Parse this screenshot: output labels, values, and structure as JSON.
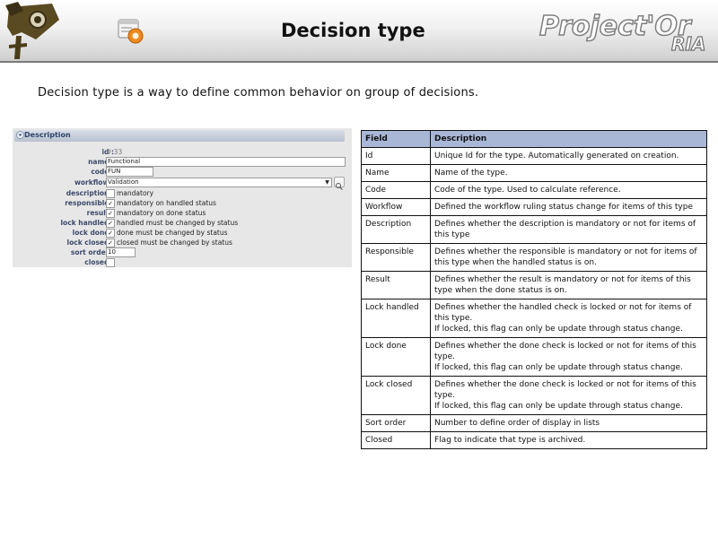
{
  "header": {
    "title": "Decision type",
    "brand": {
      "main": "Project'Or",
      "sub": "RIA"
    }
  },
  "intro": "Decision type is a way to define common behavior on group of decisions.",
  "form": {
    "section_title": "Description",
    "rows": [
      {
        "label": "id :",
        "type": "text",
        "value": "# 33",
        "muted": true
      },
      {
        "label": "name :",
        "type": "input",
        "value": "Functional"
      },
      {
        "label": "code :",
        "type": "input",
        "value": "FUN"
      },
      {
        "label": "workflow :",
        "type": "select",
        "value": "Validation"
      },
      {
        "label": "description :",
        "type": "checkbox",
        "checked": false,
        "text": "mandatory"
      },
      {
        "label": "responsible :",
        "type": "checkbox",
        "checked": true,
        "text": "mandatory on handled status"
      },
      {
        "label": "result :",
        "type": "checkbox",
        "checked": true,
        "text": "mandatory on done status"
      },
      {
        "label": "lock handled :",
        "type": "checkbox",
        "checked": true,
        "text": "handled must be changed by status"
      },
      {
        "label": "lock done :",
        "type": "checkbox",
        "checked": true,
        "text": "done must be changed by status"
      },
      {
        "label": "lock closed :",
        "type": "checkbox",
        "checked": true,
        "text": "closed must be changed by status"
      },
      {
        "label": "sort order :",
        "type": "input",
        "value": "10"
      },
      {
        "label": "closed :",
        "type": "checkbox",
        "checked": false,
        "text": ""
      }
    ]
  },
  "table": {
    "headers": [
      "Field",
      "Description"
    ],
    "rows": [
      {
        "field": "Id",
        "desc": [
          "Unique Id for the type. Automatically generated on creation."
        ]
      },
      {
        "field": "Name",
        "desc": [
          "Name of the type."
        ]
      },
      {
        "field": "Code",
        "desc": [
          "Code of the type. Used to calculate reference."
        ]
      },
      {
        "field": "Workflow",
        "desc": [
          "Defined the workflow ruling status change for items of this type"
        ]
      },
      {
        "field": "Description",
        "desc": [
          "Defines whether the description is mandatory or not for items of this type"
        ]
      },
      {
        "field": "Responsible",
        "desc": [
          "Defines whether the responsible is mandatory or not for items of this type when the handled status is on."
        ]
      },
      {
        "field": "Result",
        "desc": [
          "Defines whether the result is mandatory or not for items of this type when the done status is on."
        ]
      },
      {
        "field": "Lock handled",
        "desc": [
          "Defines whether the handled check is locked or not for items of this type.",
          "If locked, this flag can only be update through status change."
        ]
      },
      {
        "field": "Lock done",
        "desc": [
          "Defines whether the done check is locked or not for items of this type.",
          "If locked, this flag can only be update through status change."
        ]
      },
      {
        "field": "Lock closed",
        "desc": [
          "Defines whether the done check is locked or not for items of this type.",
          "If locked, this flag can only be update through status change."
        ]
      },
      {
        "field": "Sort order",
        "desc": [
          "Number to define order of display in lists"
        ]
      },
      {
        "field": "Closed",
        "desc": [
          "Flag to indicate that type is archived."
        ]
      }
    ]
  }
}
